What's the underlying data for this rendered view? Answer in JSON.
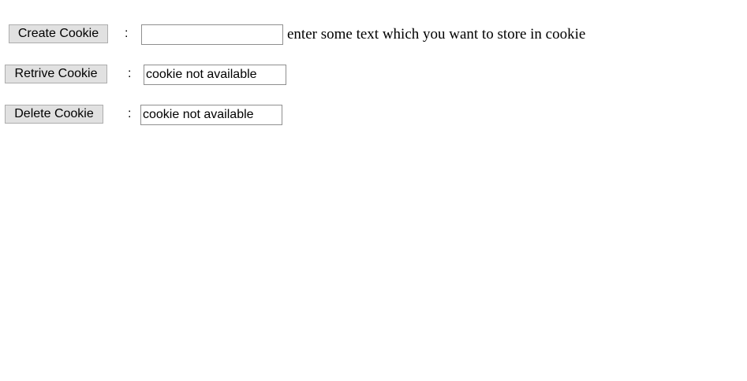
{
  "create": {
    "button_label": "Create Cookie",
    "separator": ":",
    "input_value": "",
    "hint": "enter some text which you want to store in cookie"
  },
  "retrieve": {
    "button_label": "Retrive Cookie",
    "separator": ":",
    "output_value": "cookie not available"
  },
  "delete": {
    "button_label": "Delete Cookie",
    "separator": ":",
    "output_value": "cookie not available"
  }
}
